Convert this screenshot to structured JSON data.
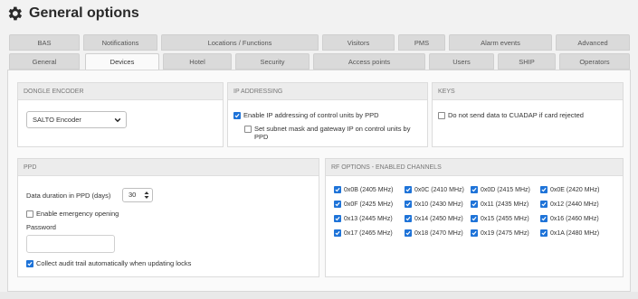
{
  "header": {
    "title": "General options"
  },
  "tabs_row1": [
    {
      "label": "BAS"
    },
    {
      "label": "Notifications"
    },
    {
      "label": "Locations / Functions"
    },
    {
      "label": "Visitors"
    },
    {
      "label": "PMS"
    },
    {
      "label": "Alarm events"
    },
    {
      "label": "Advanced"
    }
  ],
  "tabs_row2": [
    {
      "label": "General"
    },
    {
      "label": "Devices",
      "active": true
    },
    {
      "label": "Hotel"
    },
    {
      "label": "Security"
    },
    {
      "label": "Access points"
    },
    {
      "label": "Users"
    },
    {
      "label": "SHIP"
    },
    {
      "label": "Operators"
    }
  ],
  "dongle": {
    "heading": "DONGLE ENCODER",
    "selected": "SALTO Encoder"
  },
  "ip": {
    "heading": "IP ADDRESSING",
    "enable_label": "Enable IP addressing of control units by PPD",
    "enable_checked": true,
    "subnet_label_1": "Set subnet mask and gateway IP on control units by",
    "subnet_label_2": "PPD",
    "subnet_checked": false
  },
  "keys": {
    "heading": "KEYS",
    "cuadap_label": "Do not send data to CUADAP if card rejected",
    "cuadap_checked": false
  },
  "ppd": {
    "heading": "PPD",
    "duration_label": "Data duration in PPD (days)",
    "duration_value": "30",
    "emergency_label": "Enable emergency opening",
    "emergency_checked": false,
    "password_label": "Password",
    "password_value": "",
    "audit_label": "Collect audit trail automatically when updating locks",
    "audit_checked": true
  },
  "rf": {
    "heading": "RF OPTIONS - ENABLED CHANNELS",
    "channels": [
      {
        "label": "0x0B (2405 MHz)",
        "checked": true
      },
      {
        "label": "0x0C (2410 MHz)",
        "checked": true
      },
      {
        "label": "0x0D (2415 MHz)",
        "checked": true
      },
      {
        "label": "0x0E (2420 MHz)",
        "checked": true
      },
      {
        "label": "0x0F (2425 MHz)",
        "checked": true
      },
      {
        "label": "0x10 (2430 MHz)",
        "checked": true
      },
      {
        "label": "0x11 (2435 MHz)",
        "checked": true
      },
      {
        "label": "0x12 (2440 MHz)",
        "checked": true
      },
      {
        "label": "0x13 (2445 MHz)",
        "checked": true
      },
      {
        "label": "0x14 (2450 MHz)",
        "checked": true
      },
      {
        "label": "0x15 (2455 MHz)",
        "checked": true
      },
      {
        "label": "0x16 (2460 MHz)",
        "checked": true
      },
      {
        "label": "0x17 (2465 MHz)",
        "checked": true
      },
      {
        "label": "0x18 (2470 MHz)",
        "checked": true
      },
      {
        "label": "0x19 (2475 MHz)",
        "checked": true
      },
      {
        "label": "0x1A (2480 MHz)",
        "checked": true
      }
    ]
  },
  "icons": {
    "header": "gear-icon",
    "select": "chevron-down-icon",
    "spinner": "spinner-arrows-icon",
    "check": "checkmark-icon"
  },
  "colors": {
    "checkbox_on": "#1e73d8",
    "panel_header": "#ececec",
    "tab_bg": "#dadada"
  }
}
